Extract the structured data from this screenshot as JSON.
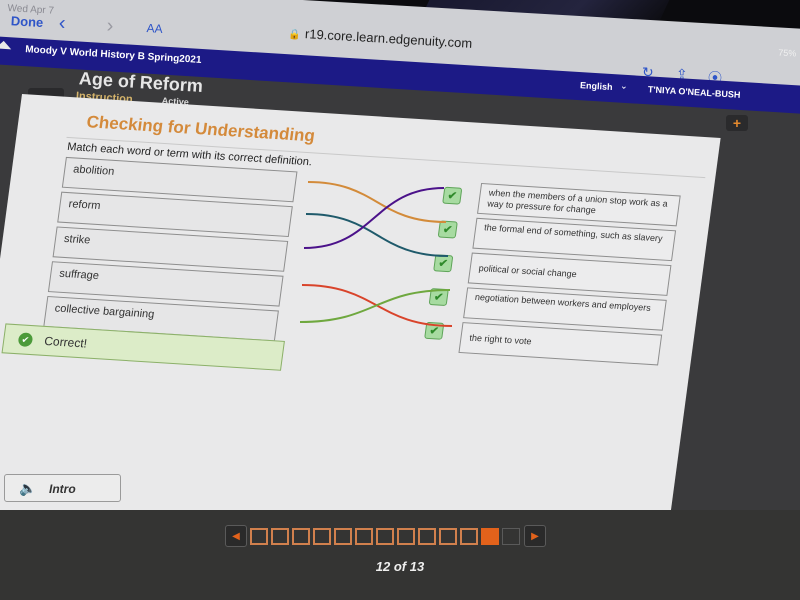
{
  "device": {
    "status_time": "Wed Apr 7",
    "battery": "75%"
  },
  "browser": {
    "done_label": "Done",
    "text_size_label": "AA",
    "url": "r19.core.learn.edgenuity.com",
    "icons": [
      "back-icon",
      "forward-icon",
      "lock-icon",
      "reload-icon",
      "share-icon",
      "compass-icon"
    ]
  },
  "header": {
    "course": "Moody V World History B Spring2021",
    "language": "English",
    "user": "T'NIYA O'NEAL-BUSH"
  },
  "lesson": {
    "title": "Age of Reform",
    "section": "Instruction",
    "state": "Active"
  },
  "activity": {
    "title": "Checking for Understanding",
    "instruction": "Match each word or term with its correct definition.",
    "terms": [
      {
        "label": "abolition",
        "color": "#d38b3a",
        "match_index": 1
      },
      {
        "label": "reform",
        "color": "#1f5a6b",
        "match_index": 2
      },
      {
        "label": "strike",
        "color": "#4b128a",
        "match_index": 0
      },
      {
        "label": "suffrage",
        "color": "#d9442b",
        "match_index": 4
      },
      {
        "label": "collective bargaining",
        "color": "#6fa83f",
        "match_index": 3
      }
    ],
    "definitions": [
      {
        "label": "when the members of a union stop work as a way to pressure for change",
        "status": "correct"
      },
      {
        "label": "the formal end of something, such as slavery",
        "status": "correct"
      },
      {
        "label": "political or social change",
        "status": "correct"
      },
      {
        "label": "negotiation between workers and employers",
        "status": "correct"
      },
      {
        "label": "the right to vote",
        "status": "correct"
      }
    ],
    "feedback": "Correct!"
  },
  "footer": {
    "intro_label": "Intro",
    "pager": {
      "current": 12,
      "total": 13,
      "label": "12 of 13"
    }
  },
  "colors": {
    "accent_orange": "#e2621b",
    "header_blue": "#1c1a86",
    "title_orange": "#d48a3b",
    "correct_green": "#4c9a3a"
  }
}
